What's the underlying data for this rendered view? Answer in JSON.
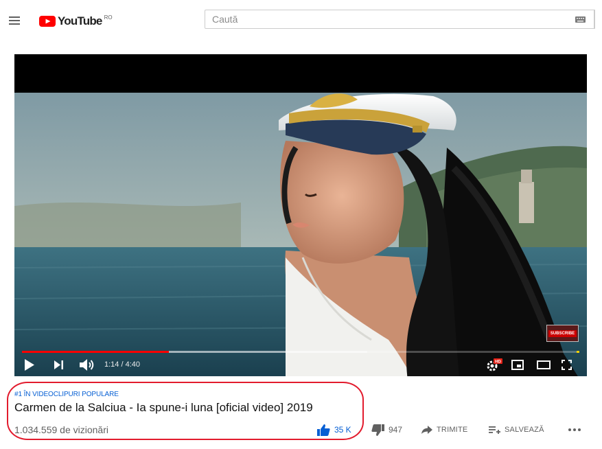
{
  "header": {
    "logo_text": "YouTube",
    "country_code": "RO",
    "search_placeholder": "Caută"
  },
  "player": {
    "time_display": "1:14 / 4:40",
    "played_fraction": 0.264,
    "buffered_fraction": 0.62,
    "subscribe_badge": "SUBSCRIBE"
  },
  "video": {
    "super_title": "#1 ÎN VIDEOCLIPURI POPULARE",
    "title": "Carmen de la Salciua - Ia spune-i luna [oficial video] 2019",
    "views": "1.034.559 de vizionări"
  },
  "actions": {
    "likes": "35 K",
    "dislikes": "947",
    "share": "TRIMITE",
    "save": "SALVEAZĂ"
  },
  "colors": {
    "brand_red": "#ff0000",
    "like_blue": "#065fd4",
    "highlight": "#e21b2d"
  }
}
